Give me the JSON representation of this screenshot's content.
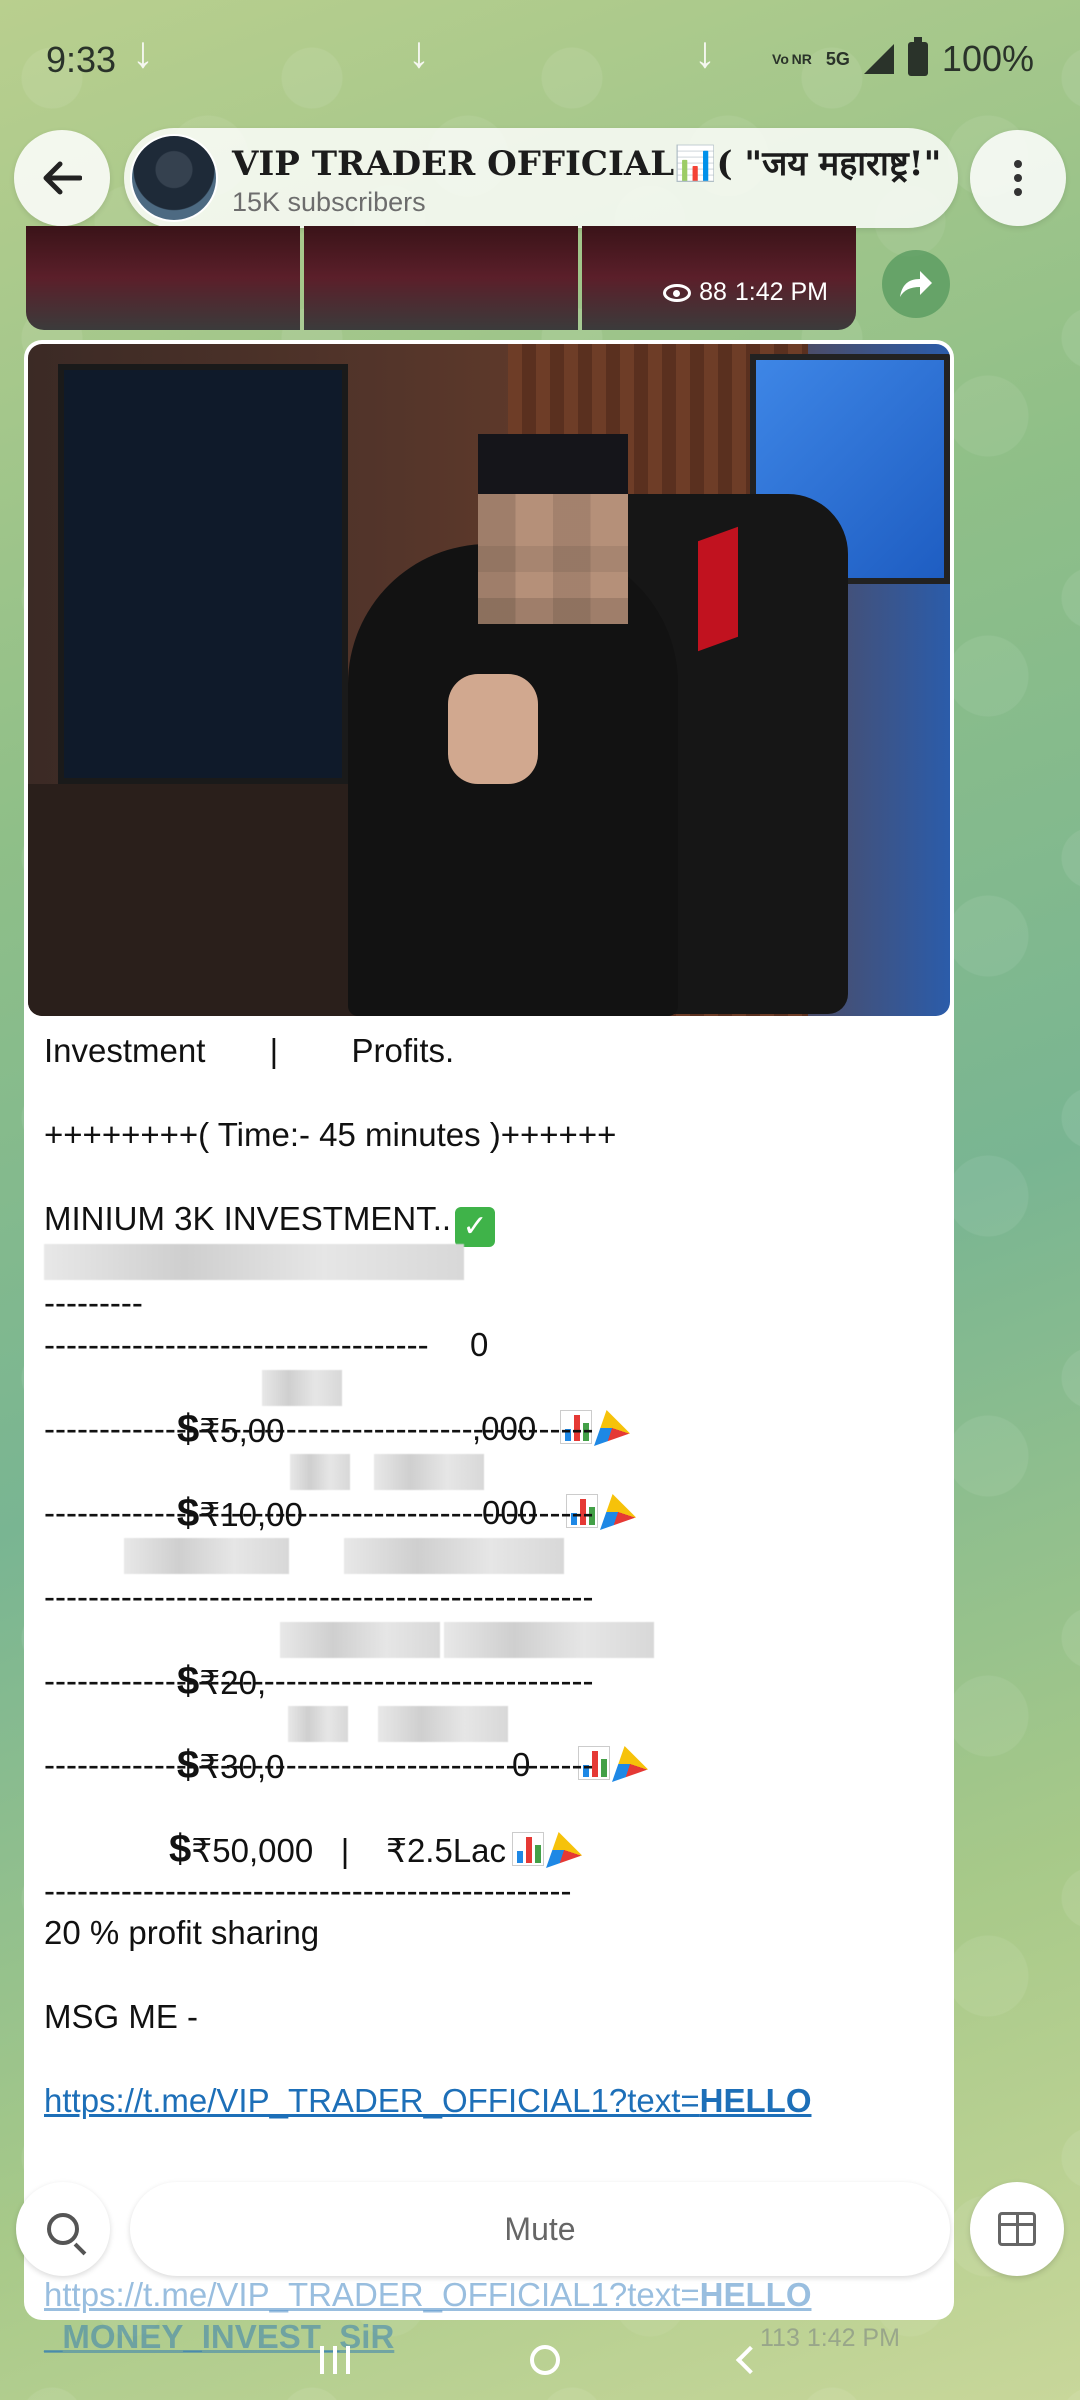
{
  "status_bar": {
    "time": "9:33",
    "network_small": "Vo NR",
    "network": "5G",
    "battery": "100%"
  },
  "header": {
    "channel_name": "VIP TRADER OFFICIAL📊( \"जय महाराष्ट्र!\"",
    "subscribers": "15K subscribers"
  },
  "prev_message": {
    "views": "88",
    "time": "1:42 PM"
  },
  "message": {
    "lines": {
      "l1": "Investment       |        Profits.",
      "l2": "++++++++( Time:- 45 minutes )++++++",
      "l3": "MINIUM 3K INVESTMENT..",
      "l4_tail": "0",
      "l5": "---------",
      "l6": "-----------------------------------",
      "r1_amount": "₹5,00",
      "r1_profit": ",000",
      "sep": "--------------------------------------------------",
      "r2_amount": "₹10,00",
      "r2_profit": "000",
      "r4_amount": "₹20,",
      "r5_amount": "₹30,0",
      "r5_profit": "0",
      "r6": "₹50,000   |    ₹2.5Lac",
      "sep_last": "------------------------------------------------",
      "profit_sharing": "20 % profit sharing",
      "msg_me": "MSG ME -",
      "link_prefix": "https://t.me/VIP_TRADER_OFFICIAL1?text=",
      "link_bold": "HELLO"
    },
    "dollar_sign": "$"
  },
  "bottom": {
    "mute_label": "Mute",
    "ghost_link_prefix": "https://t.me/VIP_TRADER_OFFICIAL1?text=",
    "ghost_link_bold": "HELLO",
    "ghost_link_line2": "_MONEY_INVEST_SiR",
    "ghost_views": "113",
    "ghost_time": "1:42 PM"
  },
  "icons": {
    "back": "arrow-left",
    "menu": "vertical-dots",
    "share": "share-arrow",
    "search": "magnifier",
    "gift": "gift-box"
  },
  "colors": {
    "link": "#1d6fb8",
    "bubble": "#ffffff",
    "check_green": "#3fb349"
  }
}
